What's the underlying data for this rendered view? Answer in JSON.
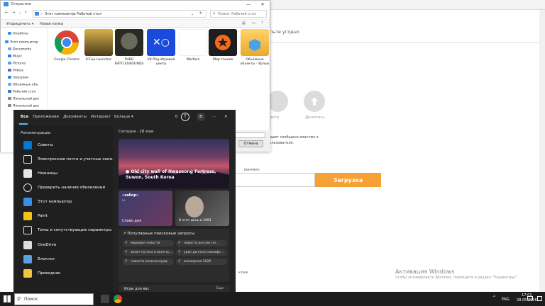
{
  "background_page": {
    "upload_title": "пьте угодно",
    "like_label": "аете",
    "share_label": "Делитесь",
    "consent_text": "ждает сообщено властям о пользователе.",
    "content_label": "контент.",
    "upload_button": "Загрузка",
    "click_text": "клик"
  },
  "activation": {
    "title": "Активация Windows",
    "subtitle": "Чтобы активировать Windows, перейдите в раздел \"Параметры\"."
  },
  "explorer": {
    "title": "Открытие",
    "address_computer": "Этот компьютер",
    "address_desktop": "Рабочий стол",
    "search_placeholder": "Поиск: Рабочий стол",
    "organize": "Упорядочить ▾",
    "new_folder": "Новая папка",
    "cancel": "Отмена",
    "nav_items": [
      "OneDrive",
      "Этот компьютер",
      "Documents",
      "Music",
      "Pictures",
      "Videos",
      "Загрузки",
      "Объемные объ",
      "Рабочий стол",
      "Локальный дис",
      "Локальный дис"
    ],
    "files": [
      {
        "name": "Google Chrome",
        "icon": "chrome-icon"
      },
      {
        "name": "ICCup Launcher",
        "icon": "iccup-icon"
      },
      {
        "name": "PUBG BATTLEGROUNDS",
        "icon": "pubg-icon"
      },
      {
        "name": "VK Play Игровой центр",
        "icon": "vkplay-icon"
      },
      {
        "name": "Warface",
        "icon": "warface-icon"
      },
      {
        "name": "Мир танков",
        "icon": "tanks-icon"
      },
      {
        "name": "Объемные объекты - Ярлык",
        "icon": "folder-icon"
      }
    ]
  },
  "start": {
    "tabs": [
      "Все",
      "Приложение",
      "Документы",
      "Интернет",
      "Больше ▾"
    ],
    "points": "0",
    "avatar_letter": "B",
    "recommendations_label": "Рекомендации",
    "recommendations": [
      {
        "label": "Советы",
        "icon": "tips-icon",
        "color": "#0078d4"
      },
      {
        "label": "Электронная почта и учетные запи...",
        "icon": "mail-icon",
        "color": "#2b2b2b"
      },
      {
        "label": "Ножницы",
        "icon": "snipping-icon",
        "color": "#e6e6e6"
      },
      {
        "label": "Проверить наличие обновлений",
        "icon": "update-icon",
        "color": "#2b2b2b"
      },
      {
        "label": "Этот компьютер",
        "icon": "computer-icon",
        "color": "#3a8ee6"
      },
      {
        "label": "Paint",
        "icon": "paint-icon",
        "color": "#f0c419"
      },
      {
        "label": "Темы и сопутствующие параметры",
        "icon": "themes-icon",
        "color": "#2b2b2b"
      },
      {
        "label": "OneDrive",
        "icon": "document-icon",
        "color": "#dddddd"
      },
      {
        "label": "Блокнот",
        "icon": "notepad-icon",
        "color": "#5aa0e0"
      },
      {
        "label": "Проводник",
        "icon": "explorer-icon",
        "color": "#f3c53c"
      }
    ],
    "today_label": "Сегодня · 28 мая",
    "hero_caption": "Old city wall of Hwaseong Fortress, Suwon, South Korea",
    "card1_logo": "«забор»",
    "card1_sub": "ru",
    "card1_label": "Слово дня",
    "card2_label": "В этот день в 1981",
    "popular_title": "Популярные поисковые запросы",
    "popular_queries": [
      "мировые новости",
      "новости россии сег...",
      "визит путина в вьетна...",
      "урок дачного манифе...",
      "новости калининград",
      "всемирная 2026"
    ],
    "games_title": "Игры для вас",
    "games_more": "Еще"
  },
  "taskbar": {
    "search_placeholder": "Поиск",
    "lang": "ENG",
    "time": "17:01",
    "date": "28.05.2026"
  }
}
